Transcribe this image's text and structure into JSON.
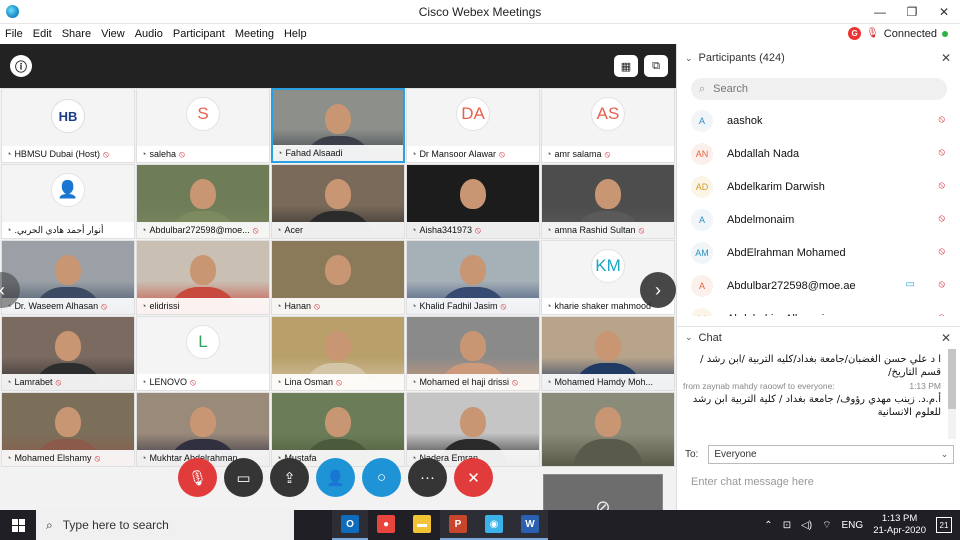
{
  "window": {
    "title": "Cisco Webex Meetings",
    "minimize": "—",
    "restore": "❐",
    "close": "✕"
  },
  "menu": [
    {
      "label": "File"
    },
    {
      "label": "Edit"
    },
    {
      "label": "Share"
    },
    {
      "label": "View"
    },
    {
      "label": "Audio"
    },
    {
      "label": "Participant"
    },
    {
      "label": "Meeting"
    },
    {
      "label": "Help"
    }
  ],
  "status": {
    "badge": "G",
    "text": "Connected"
  },
  "tiles": [
    {
      "name": "HBMSU Dubai (Host)",
      "kind": "logo",
      "logo": "HB",
      "muted": true
    },
    {
      "name": "saleha",
      "kind": "initials",
      "initials": "S",
      "muted": true
    },
    {
      "name": "Fahad Alsaadi",
      "kind": "video",
      "muted": false,
      "active": true
    },
    {
      "name": "Dr Mansoor Alawar",
      "kind": "initials",
      "initials": "DA",
      "muted": true
    },
    {
      "name": "amr salama",
      "kind": "initials",
      "initials": "AS",
      "muted": true
    },
    {
      "name": ".أنوار أحمد هادي الحربي",
      "kind": "avatar",
      "muted": false
    },
    {
      "name": "Abdulbar272598@moe...",
      "kind": "video",
      "muted": true
    },
    {
      "name": "Acer",
      "kind": "video",
      "muted": false
    },
    {
      "name": "Aisha341973",
      "kind": "video",
      "muted": true
    },
    {
      "name": "amna Rashid Sultan",
      "kind": "video",
      "muted": true
    },
    {
      "name": "Dr. Waseem Alhasan",
      "kind": "video",
      "muted": true
    },
    {
      "name": "elidrissi",
      "kind": "video",
      "muted": false
    },
    {
      "name": "Hanan",
      "kind": "video",
      "muted": true
    },
    {
      "name": "Khalid Fadhil Jasim",
      "kind": "video",
      "muted": true
    },
    {
      "name": "kharie shaker mahmood",
      "kind": "initials",
      "initials": "KM",
      "muted": false
    },
    {
      "name": "Lamrabet",
      "kind": "video",
      "muted": true
    },
    {
      "name": "LENOVO",
      "kind": "initials",
      "initials": "L",
      "muted": true
    },
    {
      "name": "Lina Osman",
      "kind": "video",
      "muted": true
    },
    {
      "name": "Mohamed el haji drissi",
      "kind": "video",
      "muted": true
    },
    {
      "name": "Mohamed Hamdy Moh...",
      "kind": "video",
      "muted": false
    },
    {
      "name": "Mohamed Elshamy",
      "kind": "video",
      "muted": true
    },
    {
      "name": "Mukhtar Abdelrahman",
      "kind": "video",
      "muted": false
    },
    {
      "name": "Mustafa",
      "kind": "video",
      "muted": false
    },
    {
      "name": "Nadera Emran",
      "kind": "video",
      "muted": false
    },
    {
      "name": "",
      "kind": "video",
      "muted": false
    }
  ],
  "participants": {
    "header": "Participants (424)",
    "search_placeholder": "Search",
    "list": [
      {
        "initials": "A",
        "name": "aashok",
        "style": "blue",
        "camera": false
      },
      {
        "initials": "AN",
        "name": "Abdallah Nada",
        "style": "orange",
        "camera": false
      },
      {
        "initials": "AD",
        "name": "Abdelkarim Darwish",
        "style": "gold",
        "camera": false
      },
      {
        "initials": "A",
        "name": "Abdelmonaim",
        "style": "blue",
        "camera": false
      },
      {
        "initials": "AM",
        "name": "AbdElrahman Mohamed",
        "style": "blue",
        "camera": false
      },
      {
        "initials": "A",
        "name": "Abdulbar272598@moe.ae",
        "style": "orange",
        "camera": true
      },
      {
        "initials": "AA",
        "name": "Abdulrahim Alhazmi",
        "style": "gold",
        "camera": false
      }
    ]
  },
  "chat": {
    "header": "Chat",
    "msg1": "ا د علي حسن الغضبان/جامعة بغداد/كليه التربية /ابن رشد /قسم التاريخ/",
    "from2": "from zaynab mahdy raoowf to everyone:",
    "time2": "1:13 PM",
    "msg2": "أ.م.د. زينب مهدي رؤوف/ جامعة بغداد / كلية التربية ابن رشد للعلوم الانسانية",
    "to_label": "To:",
    "to_value": "Everyone",
    "input_placeholder": "Enter chat message here"
  },
  "taskbar": {
    "search_placeholder": "Type here to search",
    "lang": "ENG",
    "time": "1:13 PM",
    "date": "21-Apr-2020",
    "notifications": "21",
    "apps": [
      {
        "name": "outlook",
        "glyph": "O",
        "color": "#0f6cbd"
      },
      {
        "name": "chrome",
        "glyph": "●",
        "color": "#e8453c"
      },
      {
        "name": "explorer",
        "glyph": "▬",
        "color": "#f2c335"
      },
      {
        "name": "powerpoint",
        "glyph": "P",
        "color": "#c8442a"
      },
      {
        "name": "webex",
        "glyph": "◉",
        "color": "#3ab4e8"
      },
      {
        "name": "word",
        "glyph": "W",
        "color": "#2b5fb0"
      }
    ]
  }
}
